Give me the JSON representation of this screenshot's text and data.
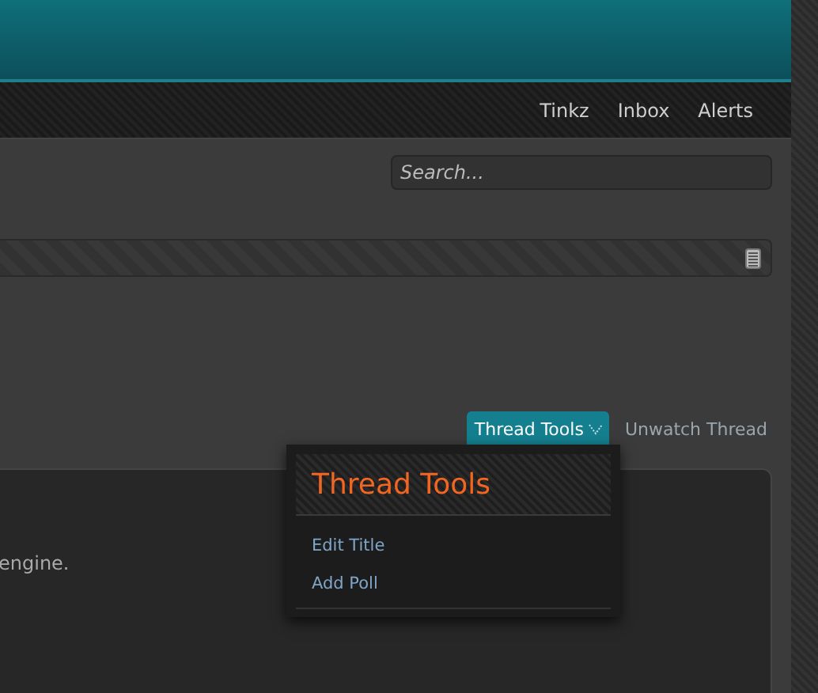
{
  "nav": {
    "links": [
      "Tinkz",
      "Inbox",
      "Alerts"
    ]
  },
  "search": {
    "placeholder": "Search..."
  },
  "thread_tools": {
    "label": "Thread Tools",
    "expanded": true
  },
  "unwatch": {
    "label": "Unwatch Thread"
  },
  "dropdown": {
    "title": "Thread Tools",
    "items": [
      "Edit Title",
      "Add Poll"
    ]
  },
  "post": {
    "text": "engine."
  }
}
